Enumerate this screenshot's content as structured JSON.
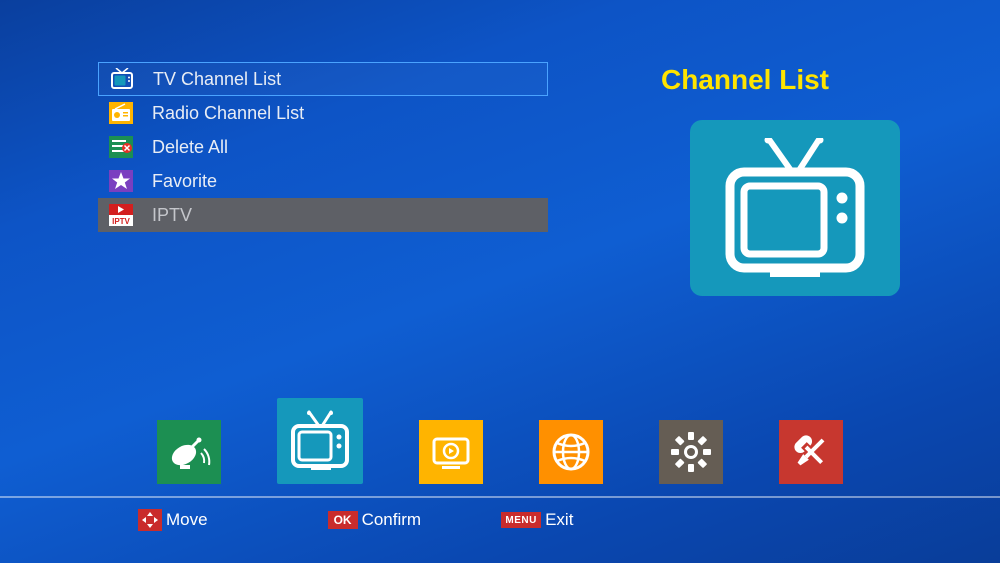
{
  "title": "Channel List",
  "menu": [
    {
      "label": "TV Channel List",
      "icon": "tv",
      "state": "selected"
    },
    {
      "label": "Radio Channel List",
      "icon": "radio",
      "state": "normal"
    },
    {
      "label": "Delete All",
      "icon": "delete",
      "state": "normal"
    },
    {
      "label": "Favorite",
      "icon": "star",
      "state": "normal"
    },
    {
      "label": "IPTV",
      "icon": "iptv",
      "state": "disabled"
    }
  ],
  "bottom_tiles": [
    "satellite",
    "tv",
    "play",
    "globe",
    "gear",
    "tools"
  ],
  "hints": {
    "move": {
      "key": "dpad",
      "label": "Move"
    },
    "confirm": {
      "key": "OK",
      "label": "Confirm"
    },
    "exit": {
      "key": "MENU",
      "label": "Exit"
    }
  },
  "colors": {
    "accent_yellow": "#ffe400",
    "tile_teal": "#1598bb"
  }
}
